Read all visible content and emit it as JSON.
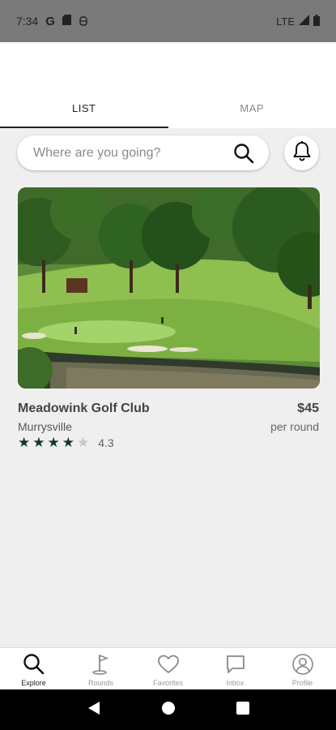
{
  "status_bar": {
    "time": "7:34",
    "network": "LTE"
  },
  "tabs": [
    {
      "label": "LIST",
      "active": true
    },
    {
      "label": "MAP",
      "active": false
    }
  ],
  "search": {
    "placeholder": "Where are you going?"
  },
  "course": {
    "name": "Meadowink Golf Club",
    "city": "Murrysville",
    "price": "$45",
    "price_unit": "per round",
    "rating": 4.3,
    "rating_text": "4.3",
    "stars_filled": 4,
    "stars_total": 5
  },
  "bottom_nav": [
    {
      "label": "Explore",
      "icon": "search-icon",
      "active": true
    },
    {
      "label": "Rounds",
      "icon": "golf-flag-icon",
      "active": false
    },
    {
      "label": "Favorites",
      "icon": "heart-icon",
      "active": false
    },
    {
      "label": "Inbox",
      "icon": "chat-icon",
      "active": false
    },
    {
      "label": "Profile",
      "icon": "profile-icon",
      "active": false
    }
  ],
  "colors": {
    "star_filled": "#0c3b1e",
    "star_empty": "#c8c8c8",
    "background": "#efefef"
  }
}
